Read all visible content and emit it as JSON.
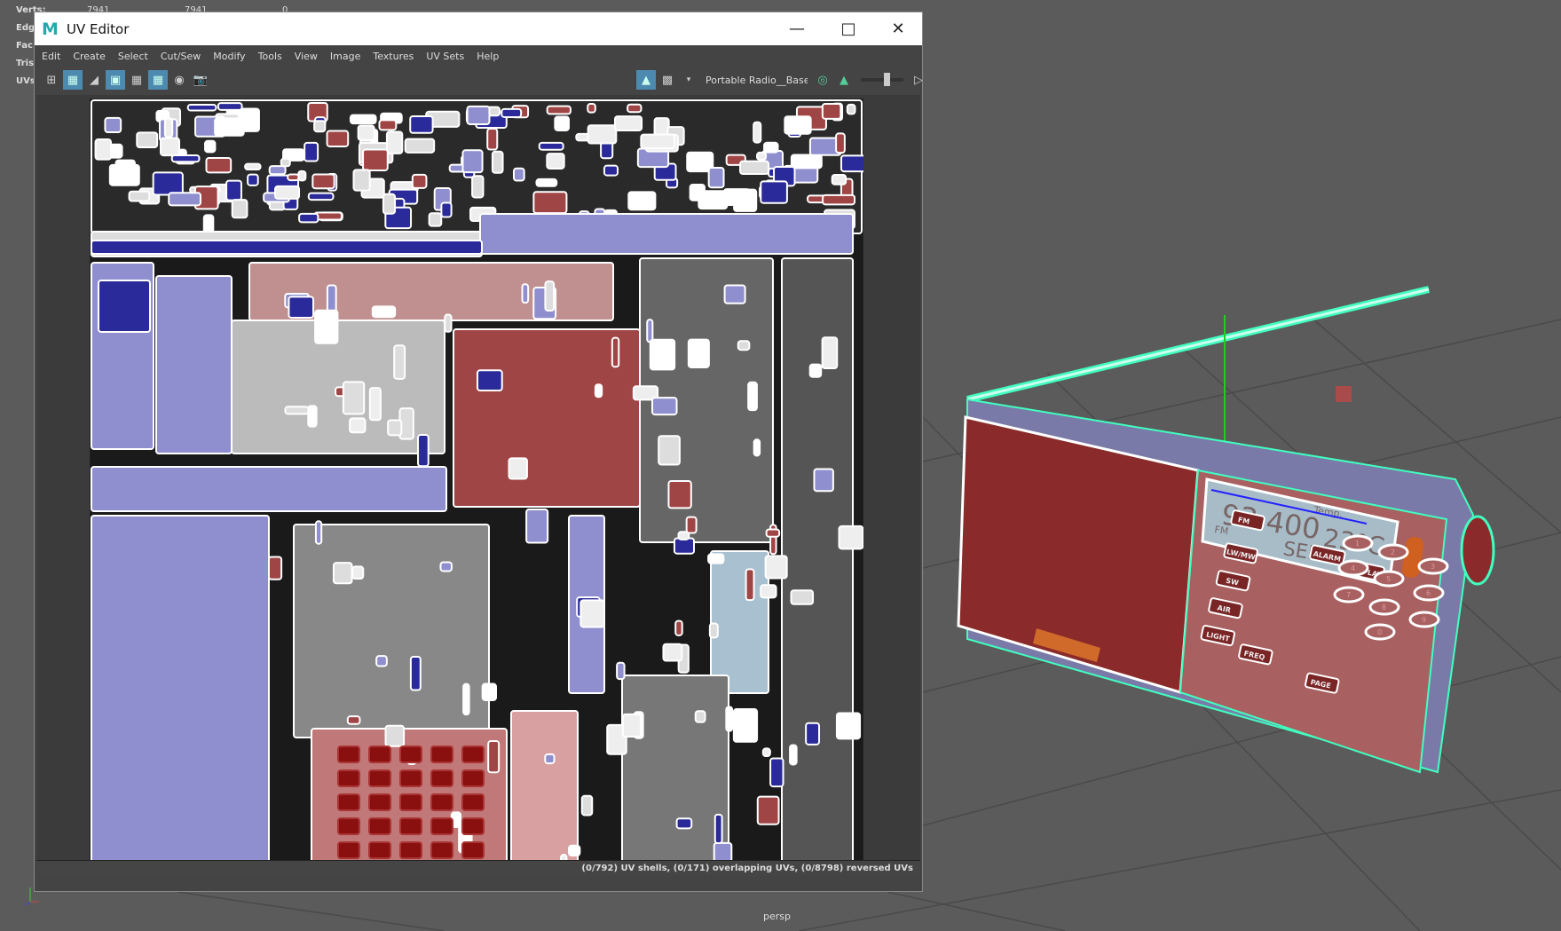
{
  "scene": {
    "stats": [
      {
        "label": "Verts:",
        "values": [
          "7941",
          "7941",
          "0"
        ]
      },
      {
        "label": "Edg",
        "values": []
      },
      {
        "label": "Fac",
        "values": []
      },
      {
        "label": "Tris",
        "values": []
      },
      {
        "label": "UVs",
        "values": []
      }
    ],
    "camera": "persp"
  },
  "window": {
    "title": "UV Editor",
    "logo": "M"
  },
  "menu": [
    "Edit",
    "Create",
    "Select",
    "Cut/Sew",
    "Modify",
    "Tools",
    "View",
    "Image",
    "Textures",
    "UV Sets",
    "Help"
  ],
  "toolbar": {
    "texture_name": "Portable Radio__Base("
  },
  "status": "(0/792) UV shells, (0/171) overlapping UVs, (0/8798) reversed UVs",
  "radio": {
    "frequency": "93.400",
    "band": "FM",
    "temp_label": "Temp.",
    "temp": "23°C",
    "mode": "SER",
    "buttons": [
      "FM",
      "LW/MW",
      "SW",
      "AIR",
      "LIGHT",
      "FREQ",
      "ALARM",
      "DISPLAY",
      "PAGE"
    ],
    "keys": [
      "1",
      "2",
      "3",
      "4",
      "5",
      "6",
      "7",
      "8",
      "9",
      "0"
    ]
  },
  "colors": {
    "lavender": "#8f8fcf",
    "red": "#a04545",
    "blue": "#2a2a9a",
    "orange": "#e07030",
    "wire": "#40ffc0"
  }
}
